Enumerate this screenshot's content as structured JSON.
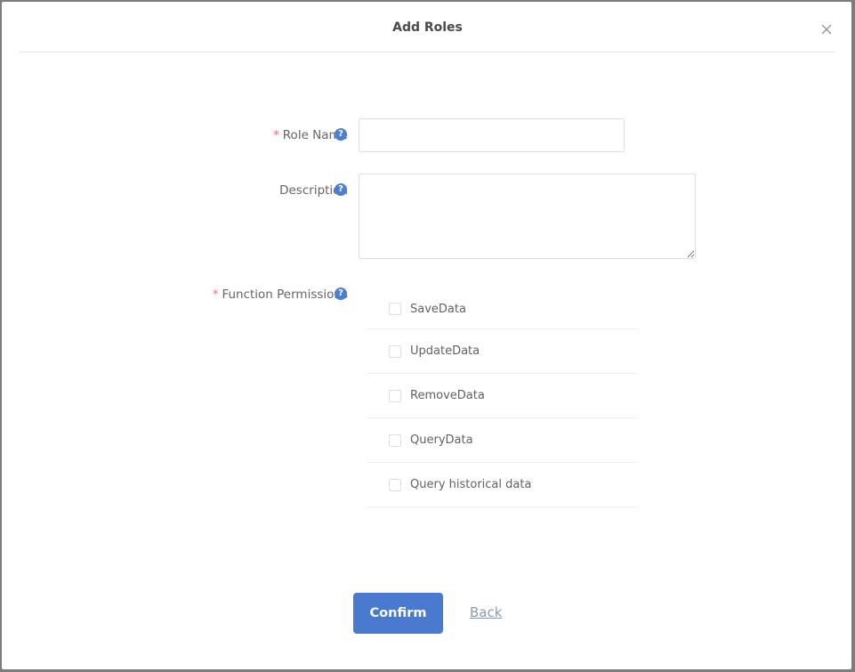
{
  "dialog": {
    "title": "Add Roles",
    "close_icon": "close-x-icon"
  },
  "form": {
    "role_name": {
      "label": "Role Name",
      "required": true,
      "required_mark": "*",
      "help_icon": "?",
      "value": "",
      "placeholder": ""
    },
    "description": {
      "label": "Description",
      "required": false,
      "help_icon": "?",
      "value": "",
      "placeholder": ""
    },
    "function_permissions": {
      "label": "Function Permissions",
      "required": true,
      "required_mark": "*",
      "help_icon": "?",
      "options": [
        {
          "label": "SaveData",
          "checked": false
        },
        {
          "label": "UpdateData",
          "checked": false
        },
        {
          "label": "RemoveData",
          "checked": false
        },
        {
          "label": "QueryData",
          "checked": false
        },
        {
          "label": "Query historical data",
          "checked": false
        }
      ]
    }
  },
  "actions": {
    "confirm_label": "Confirm",
    "back_label": "Back"
  },
  "colors": {
    "primary": "#4a7ad0",
    "required": "#f56c6c",
    "help_icon": "#4a7fd4"
  }
}
